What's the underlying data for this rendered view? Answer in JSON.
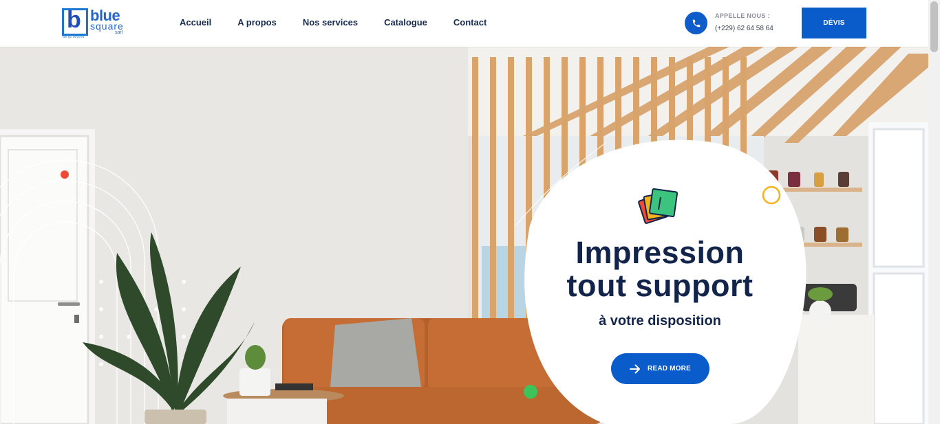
{
  "brand": {
    "logo_letter": "b",
    "word1": "blue",
    "word2": "square",
    "word3": "sarl",
    "tagline": "we go beyond"
  },
  "nav": {
    "items": [
      {
        "label": "Accueil"
      },
      {
        "label": "A propos"
      },
      {
        "label": "Nos services"
      },
      {
        "label": "Catalogue"
      },
      {
        "label": "Contact"
      }
    ]
  },
  "contact": {
    "icon": "phone-icon",
    "label": "APPELLE NOUS :",
    "number": "(+229) 62 64 58 64"
  },
  "cta": {
    "devis_label": "DÉVIS"
  },
  "hero": {
    "title_line1": "Impression",
    "title_line2": "tout support",
    "subtitle": "à votre disposition",
    "button_label": "READ MORE",
    "button_icon": "arrow-right-icon",
    "badge_icon": "cards-icon"
  },
  "colors": {
    "primary": "#0b5ccb",
    "heading": "#13244a",
    "accent_red": "#f04a36",
    "accent_orange": "#f3b21d",
    "accent_green": "#3cc45a"
  }
}
